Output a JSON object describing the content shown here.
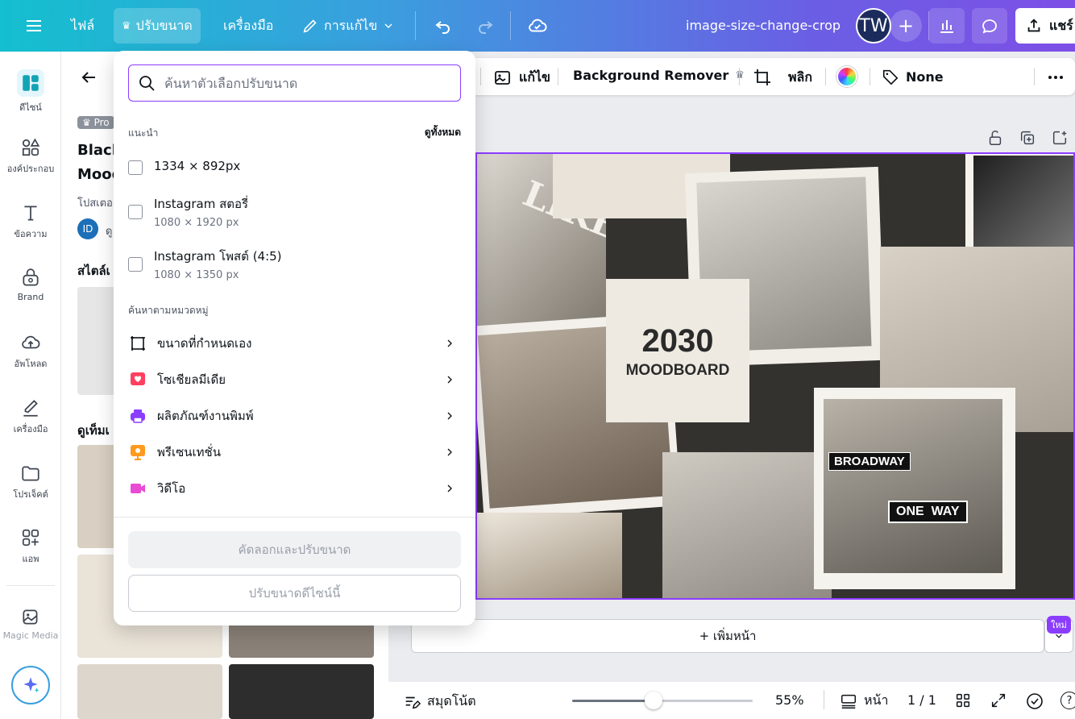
{
  "topbar": {
    "file_label": "ไฟล์",
    "resize_label": "ปรับขนาด",
    "tools_label": "เครื่องมือ",
    "edit_label": "การแก้ไข",
    "doc_title": "image-size-change-crop",
    "avatar_initials": "TW",
    "share_label": "แชร์"
  },
  "rail": {
    "items": [
      {
        "label": "ดีไซน์",
        "icon": "design-icon"
      },
      {
        "label": "องค์ประกอบ",
        "icon": "elements-icon"
      },
      {
        "label": "ข้อความ",
        "icon": "text-icon"
      },
      {
        "label": "Brand",
        "icon": "brand-icon"
      },
      {
        "label": "อัพโหลด",
        "icon": "upload-icon"
      },
      {
        "label": "เครื่องมือ",
        "icon": "draw-icon"
      },
      {
        "label": "โปรเจ็คต์",
        "icon": "folder-icon"
      },
      {
        "label": "แอพ",
        "icon": "apps-icon"
      },
      {
        "label": "Magic Media",
        "icon": "magic-media-icon"
      }
    ]
  },
  "panel": {
    "pro_badge": "Pro",
    "title_line1": "Black",
    "title_line2": "Mood",
    "subtitle": "โปสเตอ",
    "author_initials": "ID",
    "author_prefix": "ดู",
    "styles_label": "สไตล์เ",
    "items_label": "ดูเท็มเ"
  },
  "context_toolbar": {
    "edit_label": "แก้ไข",
    "bg_remover_label": "Background Remover",
    "flip_label": "พลิก",
    "none_label": "None"
  },
  "artboard": {
    "year": "2030",
    "moodboard": "MOODBOARD",
    "sign1": "BROADWAY",
    "sign2": "ONE  WAY",
    "mag": "LIKE"
  },
  "add_page_label": "+ เพิ่มหน้า",
  "new_badge": "ใหม่",
  "bottombar": {
    "notes_label": "สมุดโน้ต",
    "zoom": "55%",
    "zoom_fraction": 0.55,
    "page_label": "หน้า",
    "page_count": "1 / 1"
  },
  "resize_dropdown": {
    "search_placeholder": "ค้นหาตัวเลือกปรับขนาด",
    "suggested_label": "แนะนำ",
    "see_all": "ดูทั้งหมด",
    "options": [
      {
        "name": "1334 × 892px",
        "sub": ""
      },
      {
        "name": "Instagram สตอรี่",
        "sub": "1080 × 1920 px"
      },
      {
        "name": "Instagram โพสต์ (4:5)",
        "sub": "1080 × 1350 px"
      }
    ],
    "category_label": "ค้นหาตามหมวดหมู่",
    "categories": [
      {
        "label": "ขนาดที่กำหนดเอง",
        "icon": "custom-size-icon",
        "color": "#0e1318"
      },
      {
        "label": "โซเชียลมีเดีย",
        "icon": "social-heart-icon",
        "color": "#ff4060"
      },
      {
        "label": "ผลิตภัณฑ์งานพิมพ์",
        "icon": "print-icon",
        "color": "#8b3dff"
      },
      {
        "label": "พรีเซนเทชั่น",
        "icon": "presentation-icon",
        "color": "#ff9a1f"
      },
      {
        "label": "วิดีโอ",
        "icon": "video-icon",
        "color": "#e94bd4"
      }
    ],
    "copy_resize_label": "คัดลอกและปรับขนาด",
    "resize_this_label": "ปรับขนาดดีไซน์นี้"
  }
}
